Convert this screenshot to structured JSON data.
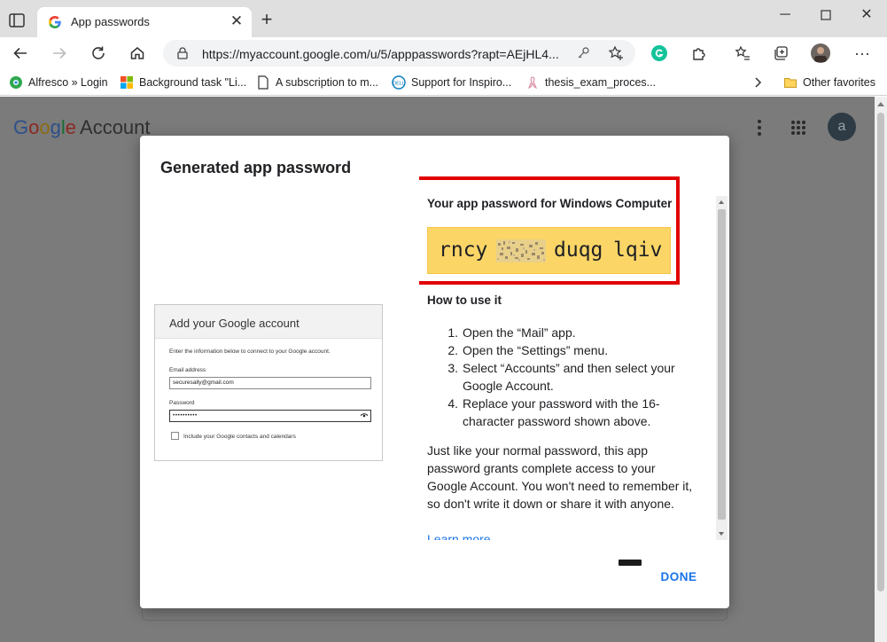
{
  "browser": {
    "tab": {
      "title": "App passwords",
      "favicon": "google-g-icon"
    },
    "address_bar": {
      "url": "https://myaccount.google.com/u/5/apppasswords?rapt=AEjHL4..."
    },
    "bookmarks": [
      {
        "label": "Alfresco » Login",
        "icon": "alfresco-icon"
      },
      {
        "label": "Background task \"Li...",
        "icon": "microsoft-icon"
      },
      {
        "label": "A subscription to m...",
        "icon": "page-icon"
      },
      {
        "label": "Support for Inspiro...",
        "icon": "dell-icon"
      },
      {
        "label": "thesis_exam_proces...",
        "icon": "ribbon-icon"
      }
    ],
    "other_favorites": "Other favorites"
  },
  "page": {
    "logo": {
      "g1": "G",
      "g2": "o",
      "g3": "o",
      "g4": "g",
      "g5": "l",
      "g6": "e",
      "account": "Account"
    },
    "avatar_letter": "a"
  },
  "dialog": {
    "title": "Generated app password",
    "password_label": "Your app password for Windows Computer",
    "password_parts": [
      "rncy",
      "duqg",
      "lqiv"
    ],
    "how_title": "How to use it",
    "steps": [
      "Open the “Mail” app.",
      "Open the “Settings” menu.",
      "Select “Accounts” and then select your Google Account.",
      "Replace your password with the 16-character password shown above."
    ],
    "note": "Just like your normal password, this app password grants complete access to your Google Account. You won't need to remember it, so don't write it down or share it with anyone.",
    "learn_more": "Learn more",
    "done_label": "DONE",
    "preview": {
      "title": "Add your Google account",
      "intro": "Enter the information below to connect to your Google account.",
      "email_label": "Email address",
      "email_value": "securesally@gmail.com",
      "password_label": "Password",
      "password_value": "••••••••••",
      "checkbox_label": "Include your Google contacts and calendars"
    }
  },
  "colors": {
    "highlight_border": "#e00000",
    "password_bg": "#fbd667",
    "link": "#1a73e8"
  }
}
